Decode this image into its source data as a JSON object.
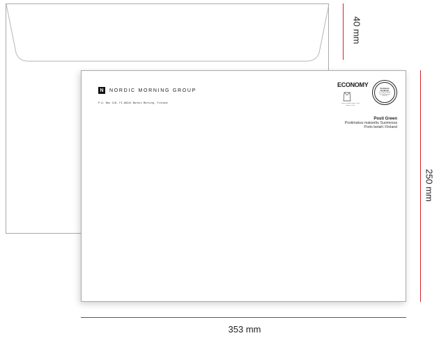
{
  "envelope": {
    "logo_letter": "N",
    "brand_name": "NORDIC MORNING GROUP",
    "return_address": "P.O. Box 118, FI-00241 Nordic Morning, Finland",
    "economy_label": "ECONOMY",
    "economy_note": "Choose suitable stamp. Check details at Posti.",
    "stamp_line1": "Postituotu",
    "stamp_line2": "Postburet",
    "stamp_line3": "Port Payé Finlande",
    "stamp_line4": "Pre Paid Envelope",
    "stamp_line5": "Posti Oy",
    "postage_title": "Posti Green",
    "postage_line1": "Postimaksu maksettu Suomessa",
    "postage_line2": "Porto betalt i Finland"
  },
  "dimensions": {
    "flap": "40 mm",
    "height": "250 mm",
    "width": "353 mm"
  },
  "colors": {
    "dimension_line": "#d81f26",
    "envelope_border": "#a9a9a9"
  }
}
